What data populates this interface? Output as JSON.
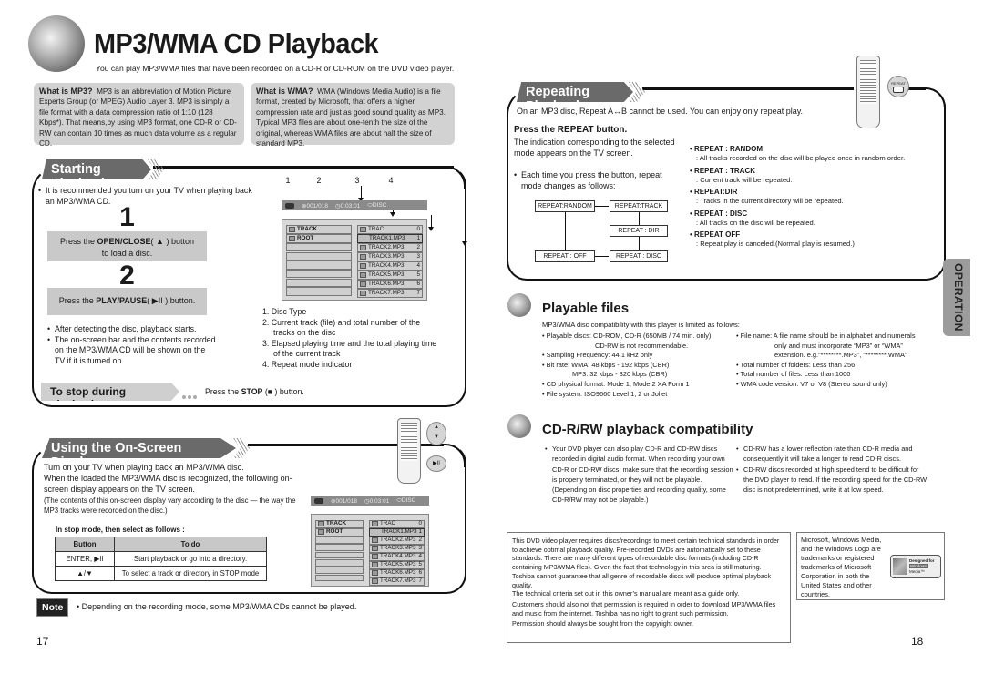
{
  "header": {
    "title": "MP3/WMA CD Playback",
    "subtitle": "You can play MP3/WMA files that have been recorded on a CD-R or CD-ROM on the DVD video player."
  },
  "info_mp3": {
    "heading": "What is MP3?",
    "text": "MP3 is an abbreviation of Motion Picture Experts Group (or MPEG) Audio Layer 3. MP3 is simply a file format with a data compression ratio of 1:10 (128 Kbps*). That means,by using MP3 format, one CD-R or CD-RW can contain 10 times as much data volume as a regular CD."
  },
  "info_wma": {
    "heading": "What is WMA?",
    "text": "WMA (Windows Media Audio) is a file format, created by Microsoft, that offers a higher compression rate and just as good sound quality as MP3. Typical MP3 files are about one-tenth the size of the original, whereas WMA files are about half the size of standard MP3."
  },
  "starting": {
    "banner": "Starting Playback",
    "intro": "It is recommended you turn on your TV when playing back an MP3/WMA CD.",
    "step1": {
      "num": "1",
      "pre": "Press the ",
      "bold": "OPEN/CLOSE",
      "post": "( ▲ ) button",
      "line2": "to load a disc."
    },
    "step2": {
      "num": "2",
      "pre": "Press the ",
      "bold": "PLAY/PAUSE",
      "post": "(  ▶II  ) button."
    },
    "notes": [
      "After detecting the disc, playback starts.",
      "The on-screen bar and the contents recorded on the MP3/WMA CD will be shown on the TV if it is turned on."
    ],
    "stop_banner": "To stop during playback",
    "stop_pre": "Press the ",
    "stop_bold": "STOP",
    "stop_post": " (■ ) button.",
    "callout_numbers": [
      "1",
      "2",
      "3",
      "4"
    ],
    "legend": [
      "1. Disc Type",
      "2. Current track (file) and total number of the tracks on the disc",
      "3. Elapsed playing time and the total playing time of the current track",
      "4. Repeat mode indicator"
    ]
  },
  "osd": {
    "track": "001/018",
    "time": "0:03:01",
    "repeat": "DISC",
    "left": [
      "TRACK",
      "ROOT",
      "",
      "",
      "",
      "",
      "",
      ""
    ],
    "right": [
      {
        "name": "TRAC",
        "num": "0"
      },
      {
        "name": "TRACK1.MP3",
        "num": "1",
        "selected": true
      },
      {
        "name": "TRACK2.MP3",
        "num": "2"
      },
      {
        "name": "TRACK3.MP3",
        "num": "3"
      },
      {
        "name": "TRACK4.MP3",
        "num": "4"
      },
      {
        "name": "TRACK5.MP3",
        "num": "5"
      },
      {
        "name": "TRACK6.MP3",
        "num": "6"
      },
      {
        "name": "TRACK7.MP3",
        "num": "7"
      }
    ]
  },
  "onscreen": {
    "banner": "Using the On-Screen Display",
    "p1": "Turn on your TV when playing back an MP3/WMA disc.",
    "p2": "When the loaded the MP3/WMA disc is recognized, the following on-screen display appears on the TV screen.",
    "p3": "(The contents of this on-screen display vary according to the disc — the way the MP3 tracks were recorded on the disc.)",
    "table_caption": "In stop mode, then select as follows :",
    "table_headers": [
      "Button",
      "To do"
    ],
    "table_rows": [
      [
        "ENTER, ▶II",
        "Start playback or go into a directory."
      ],
      [
        "▲/▼",
        "To select a track or directory in STOP mode"
      ]
    ]
  },
  "note": {
    "label": "Note",
    "text": "• Depending on the recording mode, some MP3/WMA CDs cannot be played."
  },
  "repeating": {
    "banner": "Repeating Playback",
    "intro": "On an MP3 disc, Repeat A↔B cannot be used. You can enjoy only repeat play.",
    "press_heading": "Press the REPEAT button.",
    "press_text": "The indication corresponding to the selected mode appears on the TV screen.",
    "each_time": "Each time you press the button, repeat mode changes as follows:",
    "flow": [
      "REPEAT:RANDOM",
      "REPEAT:TRACK",
      "REPEAT : DIR",
      "REPEAT : DISC",
      "REPEAT : OFF"
    ],
    "modes": [
      {
        "name": "REPEAT : RANDOM",
        "desc": ": All tracks recorded on the disc will be played once in random order."
      },
      {
        "name": "REPEAT : TRACK",
        "desc": ": Current track will be repeated."
      },
      {
        "name": "REPEAT:DIR",
        "desc": ": Tracks in the current directory will be repeated."
      },
      {
        "name": "REPEAT : DISC",
        "desc": ": All tracks on the disc will be repeated."
      },
      {
        "name": "REPEAT OFF",
        "desc": ": Repeat play is canceled.(Normal play is resumed.)"
      }
    ],
    "remote_button_label": "REPEAT"
  },
  "playable": {
    "title": "Playable files",
    "intro": "MP3/WMA disc compatibility with this player is limited as follows:",
    "left": [
      "Playable discs: CD-ROM, CD-R (650MB / 74 min. only)",
      "CD-RW is not recommendable.",
      "Sampling Frequency: 44.1 kHz only",
      "Bit rate: WMA: 48 kbps - 192 kbps (CBR)",
      "MP3: 32 kbps - 320 kbps (CBR)",
      "CD physical format: Mode 1, Mode 2 XA Form 1",
      "File system: ISO9660 Level 1, 2 or Joliet"
    ],
    "right": [
      "File name: A file name should be in alphabet and numerals",
      "only and must incorporate “MP3” or “WMA”",
      "extension. e.g.“********.MP3”, “********.WMA”",
      "Total number of folders: Less than 256",
      "Total number of files: Less than 1000",
      "WMA code version: V7 or V8 (Stereo sound only)"
    ]
  },
  "cdrw": {
    "title": "CD-R/RW playback compatibility",
    "left": "Your DVD player can also play CD-R and CD-RW discs recorded in digital audio format. When recording your own CD-R or CD-RW discs, make sure that the recording session is properly terminated, or they will not be playable.",
    "left_paren": "(Depending on disc properties and recording quality, some CD-R/RW may not be playable.)",
    "right": [
      "CD-RW has a lower reflection rate than CD-R media and consequently it will take a longer to read CD-R discs.",
      "CD-RW discs recorded at high speed tend to be difficult for the DVD player to read. If the recording speed for the CD-RW disc is not predetermined, write it at low speed."
    ]
  },
  "disclaimer": {
    "p1": "This DVD video player requires discs/recordings to meet certain technical standards in order to achieve optimal playback quality. Pre-recorded DVDs are automatically set to these standards. There are many different types of recordable disc formats (including CD-R containing MP3/WMA files). Given the fact that technology in this area is still maturing.",
    "p2": "Toshiba cannot guarantee that all genre of recordable discs will produce optimal playback quality.",
    "p3": "The technical criteria set out in this owner’s manual are meant as a guide only.",
    "p4": "Customers should also not that permission is required in order to download MP3/WMA files and music from the internet. Toshiba has no right to grant such permission.",
    "p5": "Permission should always be sought from the copyright owner."
  },
  "trademark": {
    "text": "Microsoft, Windows Media, and the Windows Logo are trademarks or registered trademarks of Microsoft Corporation in both the United States and other countries.",
    "logo_line1": "Designed for",
    "logo_line2": "Windows",
    "logo_line3": "Media™"
  },
  "side_tab": "OPERATION",
  "page_numbers": {
    "left": "17",
    "right": "18"
  }
}
